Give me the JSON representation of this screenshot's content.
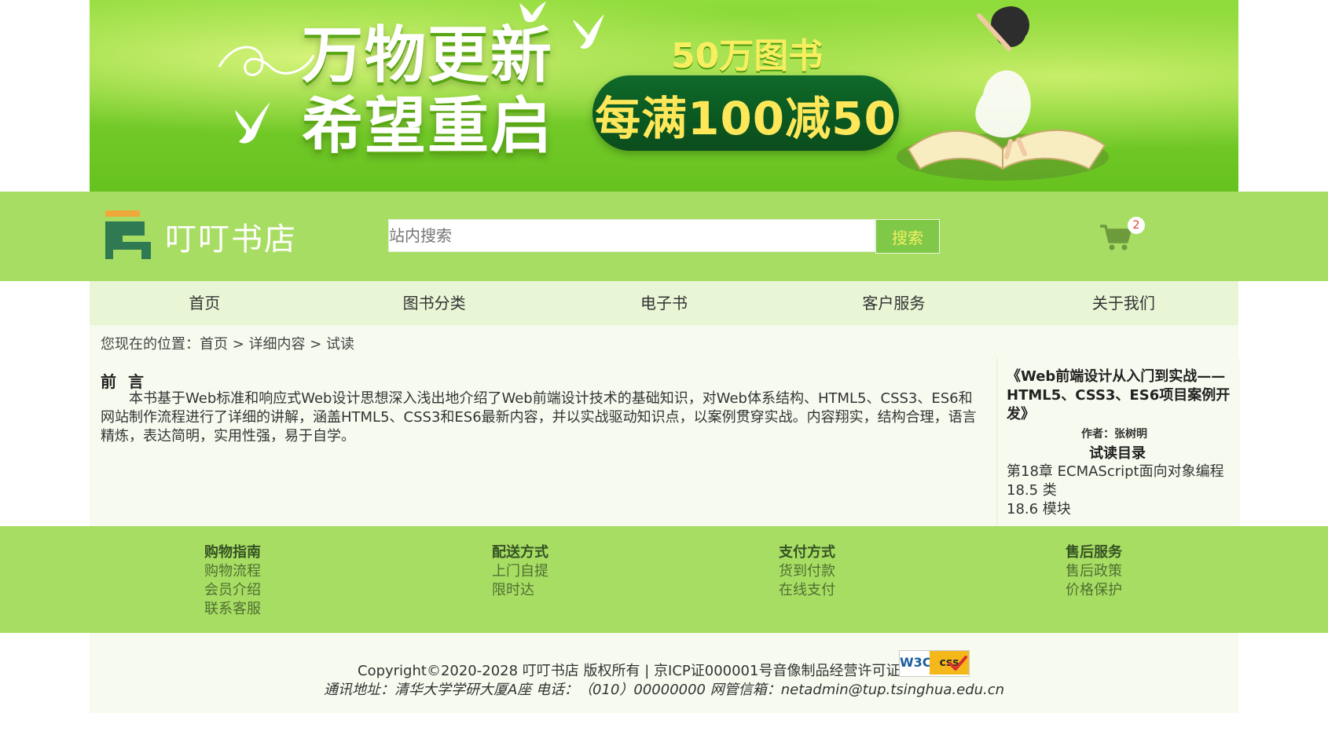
{
  "banner": {
    "title_line1": "万物更新",
    "title_line2": "希望重启",
    "sub": "50万图书",
    "promo": "每满100减50"
  },
  "header": {
    "brand": "叮叮书店",
    "search_placeholder": "站内搜索",
    "search_button": "搜索",
    "cart_count": "2"
  },
  "nav": {
    "items": [
      "首页",
      "图书分类",
      "电子书",
      "客户服务",
      "关于我们"
    ]
  },
  "breadcrumb": "您现在的位置：首页 > 详细内容 > 试读",
  "content": {
    "title": "前 言",
    "body": "本书基于Web标准和响应式Web设计思想深入浅出地介绍了Web前端设计技术的基础知识，对Web体系结构、HTML5、CSS3、ES6和网站制作流程进行了详细的讲解，涵盖HTML5、CSS3和ES6最新内容，并以实战驱动知识点，以案例贯穿实战。内容翔实，结构合理，语言精炼，表达简明，实用性强，易于自学。"
  },
  "sidebar": {
    "book_title": "《Web前端设计从入门到实战——HTML5、CSS3、ES6项目案例开发》",
    "author": "作者：张树明",
    "toc_title": "试读目录",
    "toc": [
      "第18章 ECMAScript面向对象编程",
      "18.5 类",
      "18.6 模块"
    ]
  },
  "footer": {
    "columns": [
      {
        "head": "购物指南",
        "links": [
          "购物流程",
          "会员介绍",
          "联系客服"
        ]
      },
      {
        "head": "配送方式",
        "links": [
          "上门自提",
          "限时达"
        ]
      },
      {
        "head": "支付方式",
        "links": [
          "货到付款",
          "在线支付"
        ]
      },
      {
        "head": "售后服务",
        "links": [
          "售后政策",
          "价格保护"
        ]
      }
    ],
    "copyright": "Copyright©2020-2028 叮叮书店 版权所有 | 京ICP证000001号音像制品经营许可证",
    "address": "通讯地址：清华大学学研大厦A座 电话：（010）00000000 网管信箱：netadmin@tup.tsinghua.edu.cn",
    "badge_left": "W3C",
    "badge_right": "css"
  },
  "colors": {
    "header_green": "#a8dd64",
    "nav_bg": "#e8f6d6",
    "content_bg": "#f7fbef",
    "badge_red": "#e53935"
  },
  "icons": {
    "cart": "cart-icon",
    "logo": "logo-icon"
  }
}
